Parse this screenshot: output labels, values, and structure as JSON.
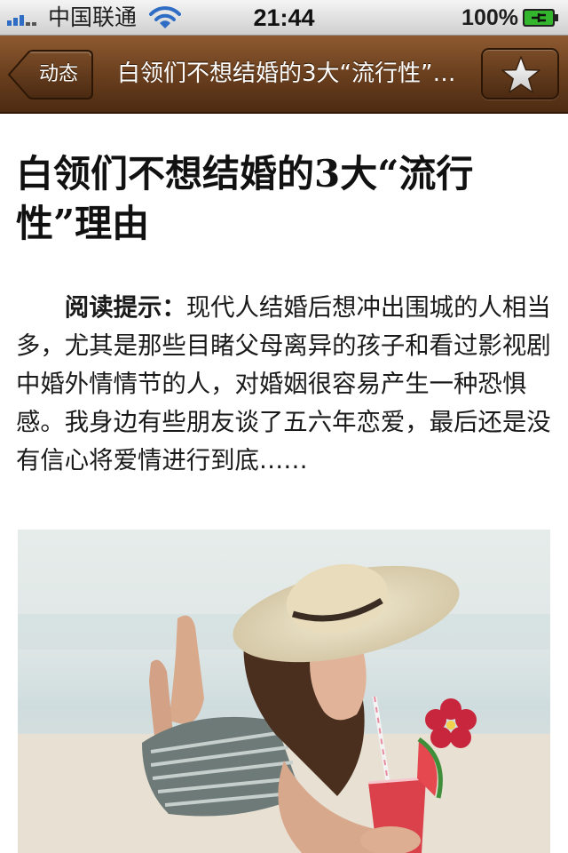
{
  "status_bar": {
    "carrier": "中国联通",
    "time": "21:44",
    "battery": "100%"
  },
  "nav": {
    "back_label": "动态",
    "title": "白领们不想结婚的3大“流行性”理由",
    "star_icon": "star-icon"
  },
  "article": {
    "title": "白领们不想结婚的3大“流行性”理由",
    "intro_label": "阅读提示：",
    "intro_text": "现代人结婚后想冲出围城的人相当多，尤其是那些目睹父母离异的孩子和看过影视剧中婚外情情节的人，对婚姻很容易产生一种恐惧感。我身边有些朋友谈了五六年恋爱，最后还是没有信心将爱情进行到底……"
  },
  "colors": {
    "nav_brown": "#6e4220",
    "status_gray": "#d8d8d8",
    "battery_green": "#34b52e"
  }
}
